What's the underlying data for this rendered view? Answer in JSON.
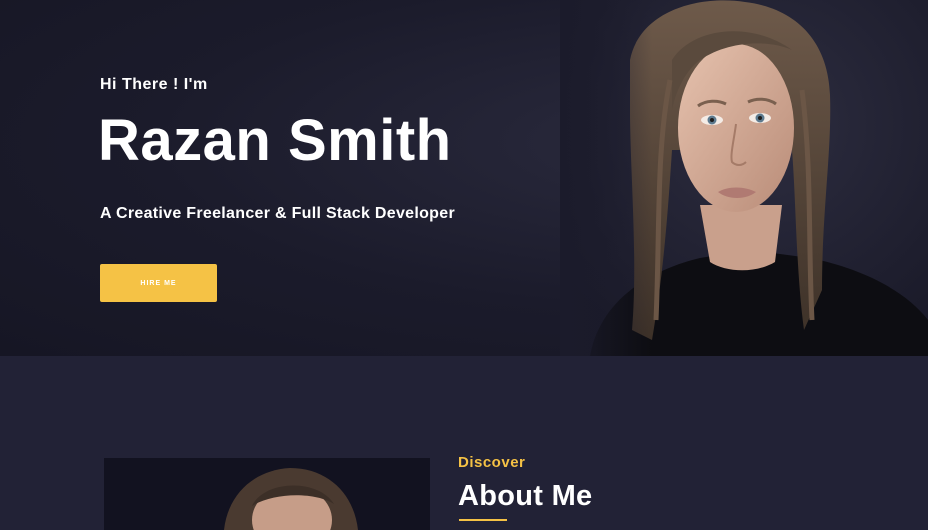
{
  "hero": {
    "greeting": "Hi There ! I'm",
    "name": "Razan Smith",
    "tagline": "A Creative Freelancer & Full Stack Developer",
    "cta_label": "HIRE ME",
    "accent_color": "#f5c245"
  },
  "about": {
    "eyebrow": "Discover",
    "title": "About Me"
  }
}
